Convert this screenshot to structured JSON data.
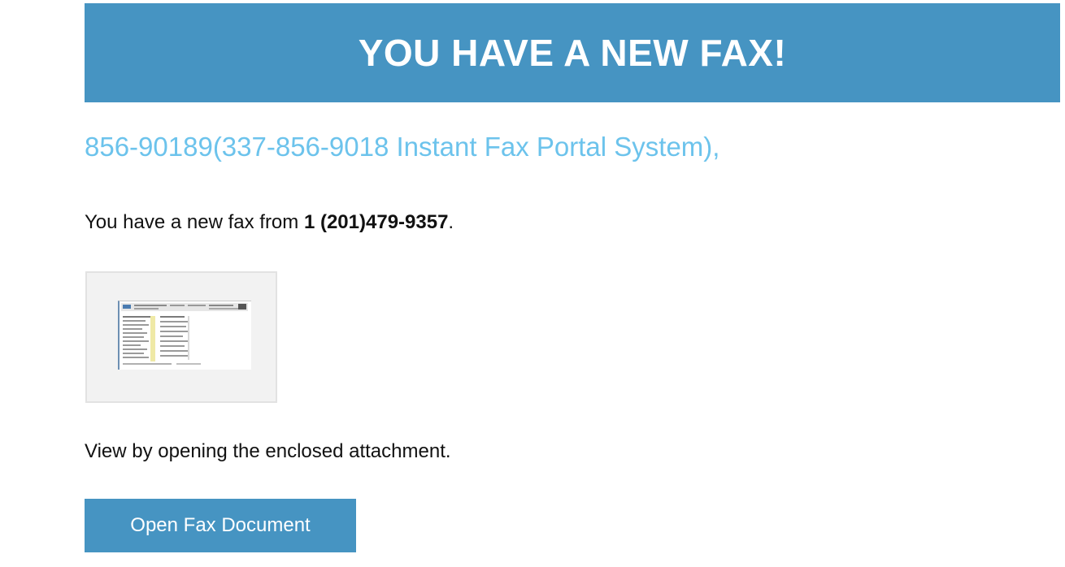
{
  "banner": {
    "title": "YOU HAVE A NEW FAX!"
  },
  "greeting": {
    "text": "856-90189(337-856-9018 Instant Fax Portal System),"
  },
  "message": {
    "prefix": "You have a new fax from ",
    "sender_number": "1 (201)479-9357",
    "suffix": "."
  },
  "attachment": {
    "icon": "document-thumbnail"
  },
  "instruction": {
    "text": "View by opening the enclosed attachment."
  },
  "cta": {
    "label": "Open Fax Document"
  },
  "colors": {
    "accent": "#4694c2",
    "greeting": "#6cc3ec",
    "text": "#111111"
  }
}
